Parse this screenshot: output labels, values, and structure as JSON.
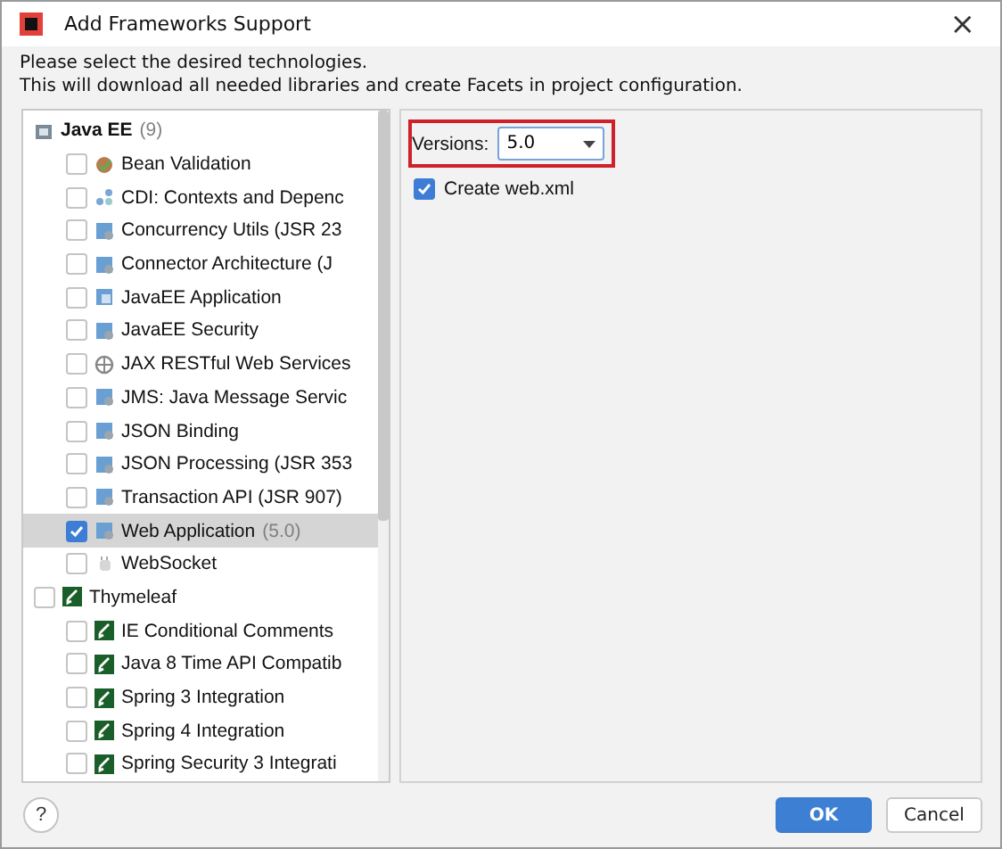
{
  "window": {
    "title": "Add Frameworks Support",
    "close": "×"
  },
  "description": [
    "Please select the desired technologies.",
    "This will download all needed libraries and create Facets in project configuration."
  ],
  "tree": [
    {
      "label": "Java EE",
      "count": "(9)",
      "kind": "folder",
      "children": [
        {
          "label": "Bean Validation",
          "kind": "bean",
          "checked": false,
          "selected": false
        },
        {
          "label": "CDI: Contexts and Depenc",
          "kind": "cdi",
          "checked": false,
          "selected": false
        },
        {
          "label": "Concurrency Utils (JSR 23",
          "kind": "module",
          "checked": false,
          "selected": false
        },
        {
          "label": "Connector Architecture (J",
          "kind": "module",
          "checked": false,
          "selected": false
        },
        {
          "label": "JavaEE Application",
          "kind": "app",
          "checked": false,
          "selected": false
        },
        {
          "label": "JavaEE Security",
          "kind": "module",
          "checked": false,
          "selected": false
        },
        {
          "label": "JAX RESTful Web Services",
          "kind": "globe",
          "checked": false,
          "selected": false
        },
        {
          "label": "JMS: Java Message Servic",
          "kind": "module",
          "checked": false,
          "selected": false
        },
        {
          "label": "JSON Binding",
          "kind": "module",
          "checked": false,
          "selected": false
        },
        {
          "label": "JSON Processing (JSR 353",
          "kind": "module",
          "checked": false,
          "selected": false
        },
        {
          "label": "Transaction API (JSR 907)",
          "kind": "module",
          "checked": false,
          "selected": false
        },
        {
          "label": "Web Application",
          "version": "(5.0)",
          "kind": "module",
          "checked": true,
          "selected": true
        },
        {
          "label": "WebSocket",
          "kind": "socket",
          "checked": false,
          "selected": false
        }
      ]
    },
    {
      "label": "Thymeleaf",
      "kind": "leaf",
      "checked": false,
      "selected": false,
      "children": [
        {
          "label": "IE Conditional Comments",
          "kind": "leaf",
          "checked": false,
          "selected": false
        },
        {
          "label": "Java 8 Time API Compatib",
          "kind": "leaf",
          "checked": false,
          "selected": false
        },
        {
          "label": "Spring 3 Integration",
          "kind": "leaf",
          "checked": false,
          "selected": false
        },
        {
          "label": "Spring 4 Integration",
          "kind": "leaf",
          "checked": false,
          "selected": false
        },
        {
          "label": "Spring Security 3 Integrati",
          "kind": "leaf",
          "checked": false,
          "selected": false
        }
      ]
    }
  ],
  "settings": {
    "versions_label": "Versions:",
    "version": "5.0",
    "create_web_xml": {
      "label": "Create web.xml",
      "checked": true
    }
  },
  "buttons": {
    "help": "?",
    "ok": "OK",
    "cancel": "Cancel"
  }
}
